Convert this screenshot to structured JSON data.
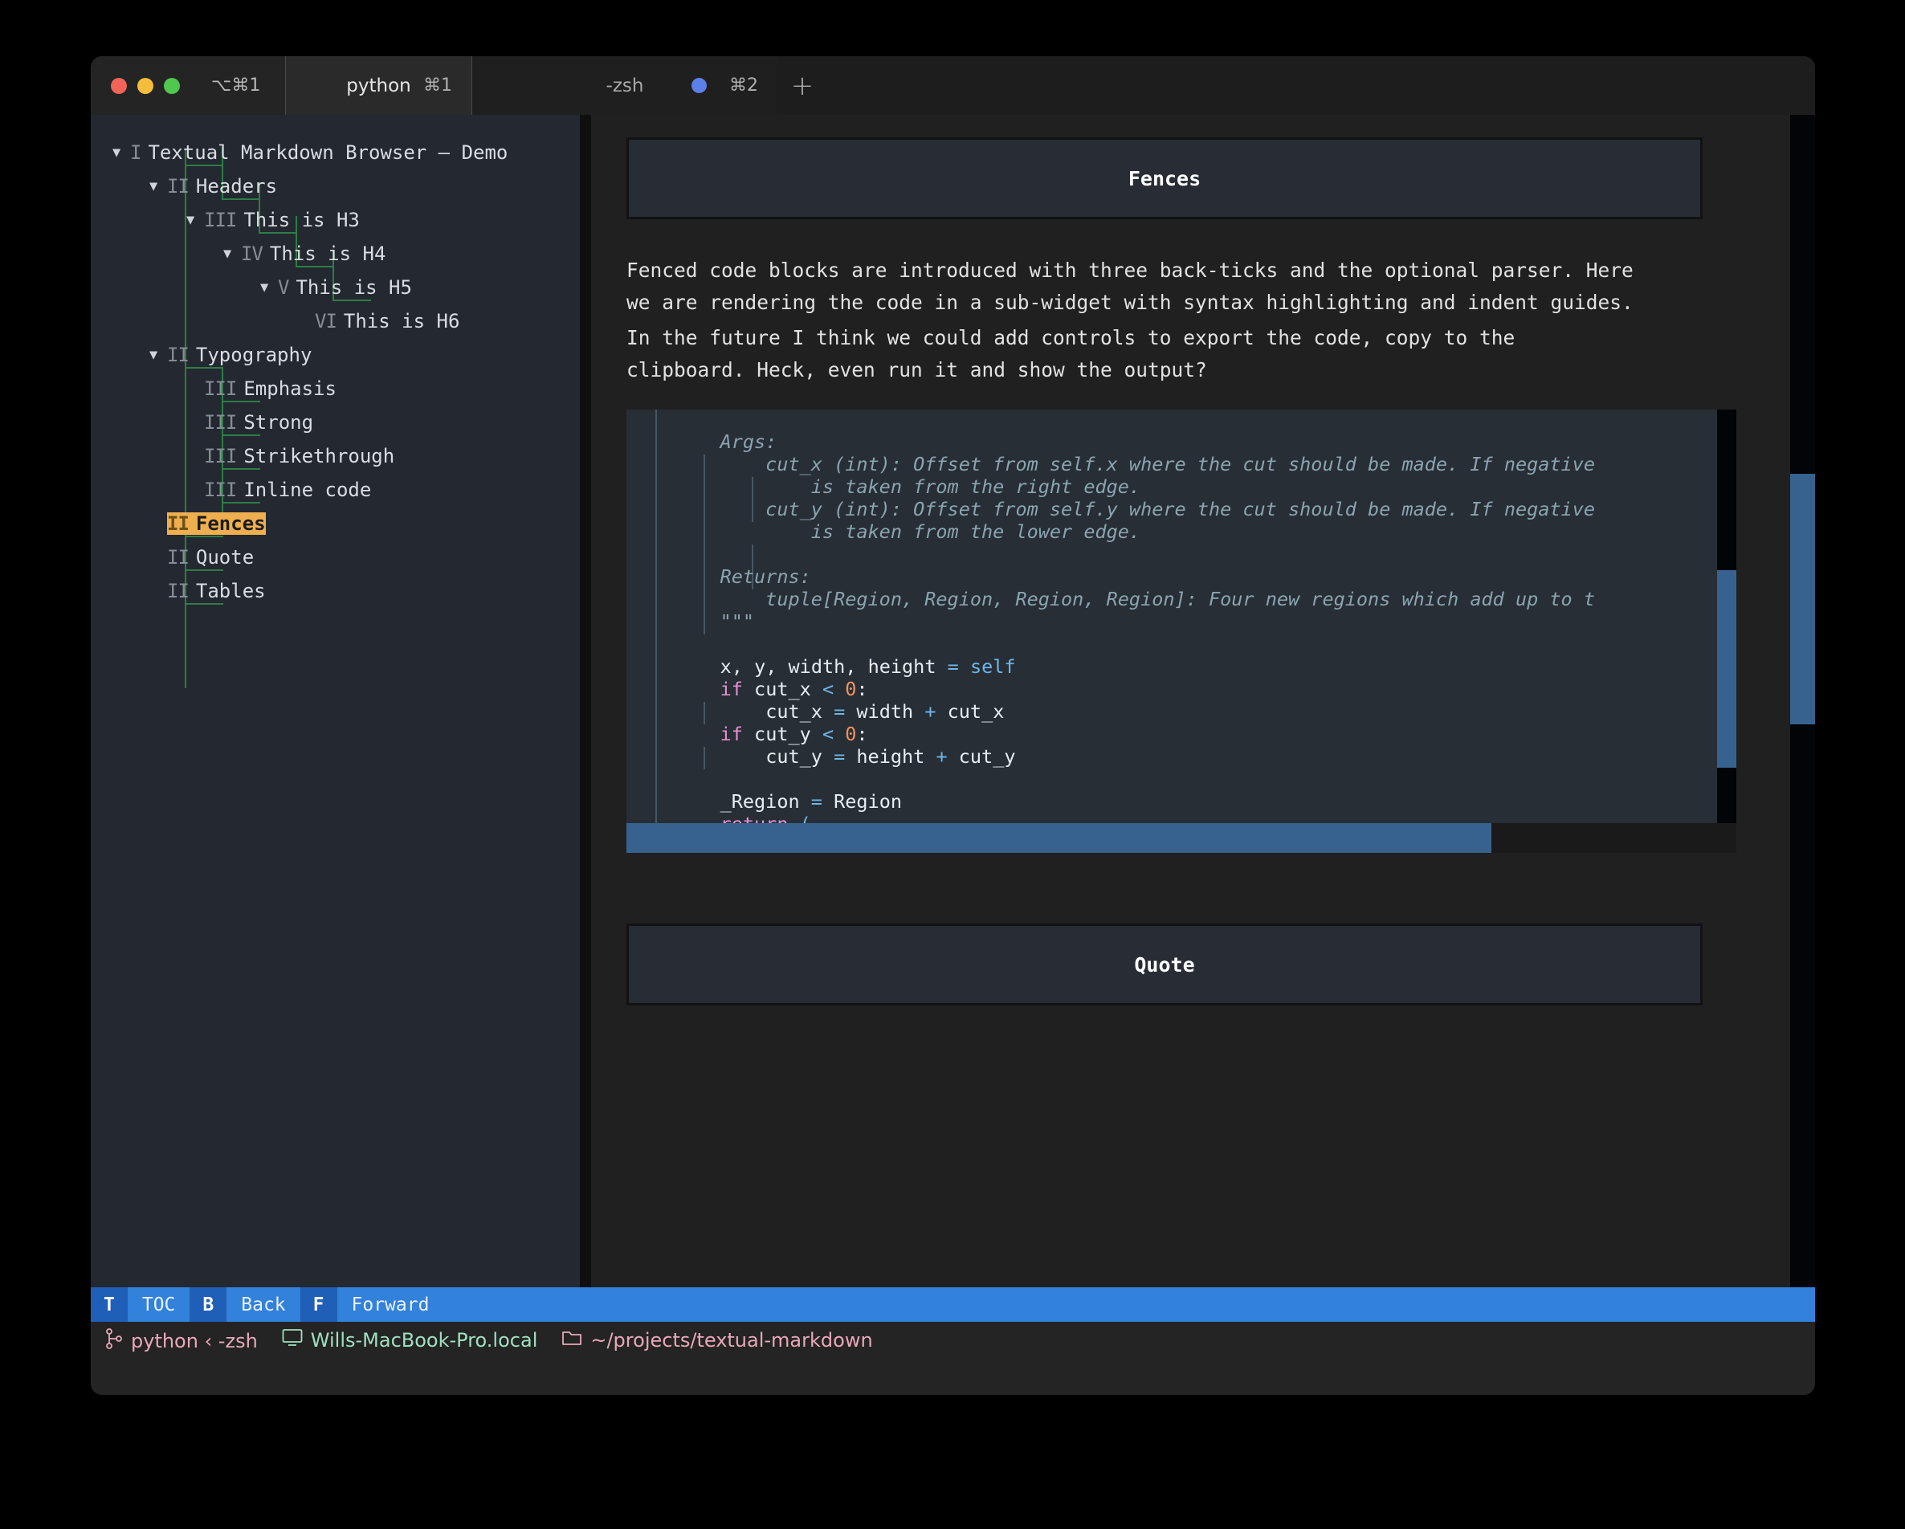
{
  "window": {
    "traffic_lights": [
      "close",
      "minimize",
      "maximize"
    ],
    "window_shortcut": "⌥⌘1"
  },
  "tabs": [
    {
      "label": "python",
      "shortcut": "⌘1",
      "active": true,
      "dot": false
    },
    {
      "label": "-zsh",
      "shortcut": "⌘2",
      "active": false,
      "dot": true
    }
  ],
  "new_tab_icon": "+",
  "sidebar": {
    "items": [
      {
        "numeral": "I",
        "label": "Textual Markdown Browser — Demo",
        "depth": 0,
        "arrow": "▼",
        "selected": false
      },
      {
        "numeral": "II",
        "label": "Headers",
        "depth": 1,
        "arrow": "▼",
        "selected": false
      },
      {
        "numeral": "III",
        "label": "This is H3",
        "depth": 2,
        "arrow": "▼",
        "selected": false
      },
      {
        "numeral": "IV",
        "label": "This is H4",
        "depth": 3,
        "arrow": "▼",
        "selected": false
      },
      {
        "numeral": "V",
        "label": "This is H5",
        "depth": 4,
        "arrow": "▼",
        "selected": false
      },
      {
        "numeral": "VI",
        "label": "This is H6",
        "depth": 5,
        "arrow": "",
        "selected": false
      },
      {
        "numeral": "II",
        "label": "Typography",
        "depth": 1,
        "arrow": "▼",
        "selected": false
      },
      {
        "numeral": "III",
        "label": "Emphasis",
        "depth": 2,
        "arrow": "",
        "selected": false
      },
      {
        "numeral": "III",
        "label": "Strong",
        "depth": 2,
        "arrow": "",
        "selected": false
      },
      {
        "numeral": "III",
        "label": "Strikethrough",
        "depth": 2,
        "arrow": "",
        "selected": false
      },
      {
        "numeral": "III",
        "label": "Inline code",
        "depth": 2,
        "arrow": "",
        "selected": false
      },
      {
        "numeral": "II",
        "label": "Fences",
        "depth": 1,
        "arrow": "",
        "selected": true
      },
      {
        "numeral": "II",
        "label": "Quote",
        "depth": 1,
        "arrow": "",
        "selected": false
      },
      {
        "numeral": "II",
        "label": "Tables",
        "depth": 1,
        "arrow": "",
        "selected": false
      }
    ],
    "selected_color": "#efaf4e",
    "guide_color": "#2e7d46"
  },
  "content": {
    "heading_fences": "Fences",
    "heading_quote": "Quote",
    "paragraph_1": "Fenced code blocks are introduced with three back-ticks and the optional parser. Here\nwe are rendering the code in a sub-widget with syntax highlighting and indent guides.",
    "paragraph_2": "In the future I think we could add controls to export the code, copy to the\nclipboard. Heck, even run it and show the output?",
    "code": {
      "language": "python",
      "lines": [
        "    Args:",
        "        cut_x (int): Offset from self.x where the cut should be made. If negative",
        "            is taken from the right edge.",
        "        cut_y (int): Offset from self.y where the cut should be made. If negative",
        "            is taken from the lower edge.",
        "",
        "    Returns:",
        "        tuple[Region, Region, Region, Region]: Four new regions which add up to t",
        "    \"\"\"",
        "",
        "    x, y, width, height = self",
        "    if cut_x < 0:",
        "        cut_x = width + cut_x",
        "    if cut_y < 0:",
        "        cut_y = height + cut_y",
        "",
        "    _Region = Region",
        "    return ("
      ]
    }
  },
  "footer": {
    "bindings": [
      {
        "key": "T",
        "label": "TOC"
      },
      {
        "key": "B",
        "label": "Back"
      },
      {
        "key": "F",
        "label": "Forward"
      }
    ],
    "accent": "#3281db"
  },
  "statusbar": {
    "segments": [
      {
        "icon": "branch-icon",
        "text": "python ‹ -zsh",
        "color": "pink"
      },
      {
        "icon": "monitor-icon",
        "text": "Wills-MacBook-Pro.local",
        "color": "green"
      },
      {
        "icon": "folder-icon",
        "text": "~/projects/textual-markdown",
        "color": "pink"
      }
    ]
  }
}
